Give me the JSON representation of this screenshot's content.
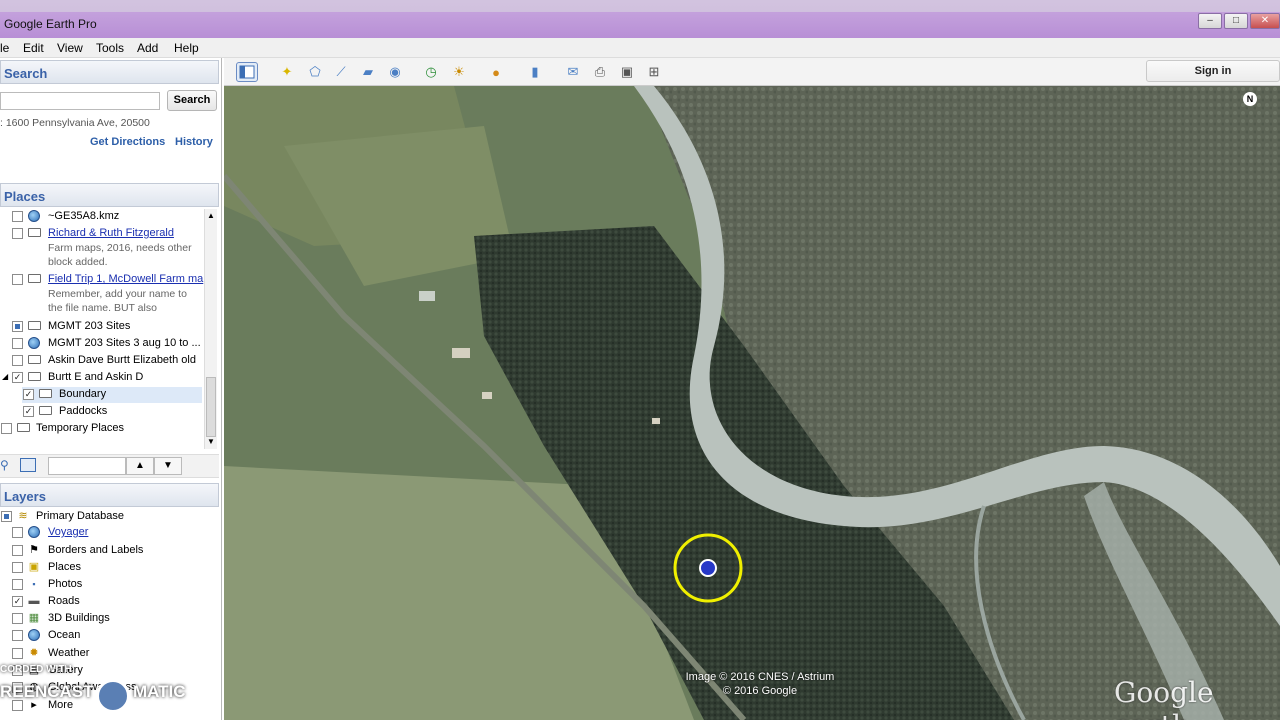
{
  "window": {
    "title": "Google Earth Pro",
    "controls": [
      "–",
      "□",
      "✕"
    ]
  },
  "menu": {
    "items": [
      "le",
      "Edit",
      "View",
      "Tools",
      "Add",
      "Help"
    ]
  },
  "toolbar": {
    "signin_label": "Sign in",
    "buttons": [
      "sidebar-toggle",
      "placemark",
      "polygon",
      "path",
      "image-overlay",
      "record-tour",
      "historical-imagery",
      "sunlight",
      "planets",
      "ruler",
      "email",
      "print",
      "save-image",
      "view-in-maps"
    ]
  },
  "search": {
    "header": "Search",
    "placeholder": "",
    "button_label": "Search",
    "example_address": ": 1600 Pennsylvania Ave, 20500",
    "get_directions": "Get Directions",
    "history": "History"
  },
  "places": {
    "header": "Places",
    "items": [
      {
        "label": "~GE35A8.kmz",
        "link": false,
        "checked": false,
        "icon": "kmz-globe-icon"
      },
      {
        "label": "Richard & Ruth Fitzgerald",
        "link": true,
        "checked": false,
        "icon": "folder-icon",
        "desc": [
          "Farm maps, 2016, needs other",
          "block added."
        ]
      },
      {
        "label": "Field Trip 1, McDowell Farm ma",
        "link": true,
        "checked": false,
        "icon": "folder-icon",
        "desc": [
          "Remember, add your name to",
          "the file name. BUT also"
        ]
      },
      {
        "label": "MGMT 203 Sites",
        "link": false,
        "checked": "partial",
        "icon": "folder-icon"
      },
      {
        "label": "MGMT 203 Sites 3 aug 10 to ...",
        "link": false,
        "checked": false,
        "icon": "kmz-globe-icon"
      },
      {
        "label": "Askin Dave Burtt Elizabeth old",
        "link": false,
        "checked": false,
        "icon": "folder-icon"
      },
      {
        "label": "Burtt E and Askin D",
        "link": false,
        "checked": true,
        "icon": "open-folder-icon"
      },
      {
        "label": "Boundary",
        "link": false,
        "checked": true,
        "icon": "folder-icon",
        "selected": true
      },
      {
        "label": "Paddocks",
        "link": false,
        "checked": true,
        "icon": "folder-icon"
      },
      {
        "label": "Temporary Places",
        "link": false,
        "checked": false,
        "icon": "folder-icon"
      }
    ]
  },
  "layers": {
    "header": "Layers",
    "items": [
      {
        "label": "Primary Database",
        "link": false,
        "checked": "partial",
        "icon": "database-icon"
      },
      {
        "label": "Voyager",
        "link": true,
        "checked": false,
        "icon": "voyager-icon"
      },
      {
        "label": "Borders and Labels",
        "link": false,
        "checked": false,
        "icon": "flag-icon"
      },
      {
        "label": "Places",
        "link": false,
        "checked": false,
        "icon": "places-icon"
      },
      {
        "label": "Photos",
        "link": false,
        "checked": false,
        "icon": "photo-icon"
      },
      {
        "label": "Roads",
        "link": false,
        "checked": true,
        "icon": "roads-icon"
      },
      {
        "label": "3D Buildings",
        "link": false,
        "checked": false,
        "icon": "buildings-icon"
      },
      {
        "label": "Ocean",
        "link": false,
        "checked": false,
        "icon": "ocean-icon"
      },
      {
        "label": "Weather",
        "link": false,
        "checked": false,
        "icon": "weather-icon"
      },
      {
        "label": "Gallery",
        "link": false,
        "checked": false,
        "icon": "gallery-icon"
      },
      {
        "label": "Global Awareness",
        "link": false,
        "checked": false,
        "icon": "awareness-icon"
      },
      {
        "label": "More",
        "link": false,
        "checked": false,
        "icon": "more-icon"
      }
    ]
  },
  "map": {
    "attribution_line1": "Image © 2016 CNES / Astrium",
    "attribution_line2": "© 2016 Google",
    "logo": "Google earth",
    "compass": "N"
  },
  "watermark": {
    "line1": "CORDED WITH",
    "line2": "REENCAST",
    "line3": "MATIC"
  },
  "colors": {
    "titlebar": "#b88fd6",
    "panel_header_text": "#3a62a8",
    "link": "#1a2fb0",
    "cursor_ring": "#f0f000"
  }
}
